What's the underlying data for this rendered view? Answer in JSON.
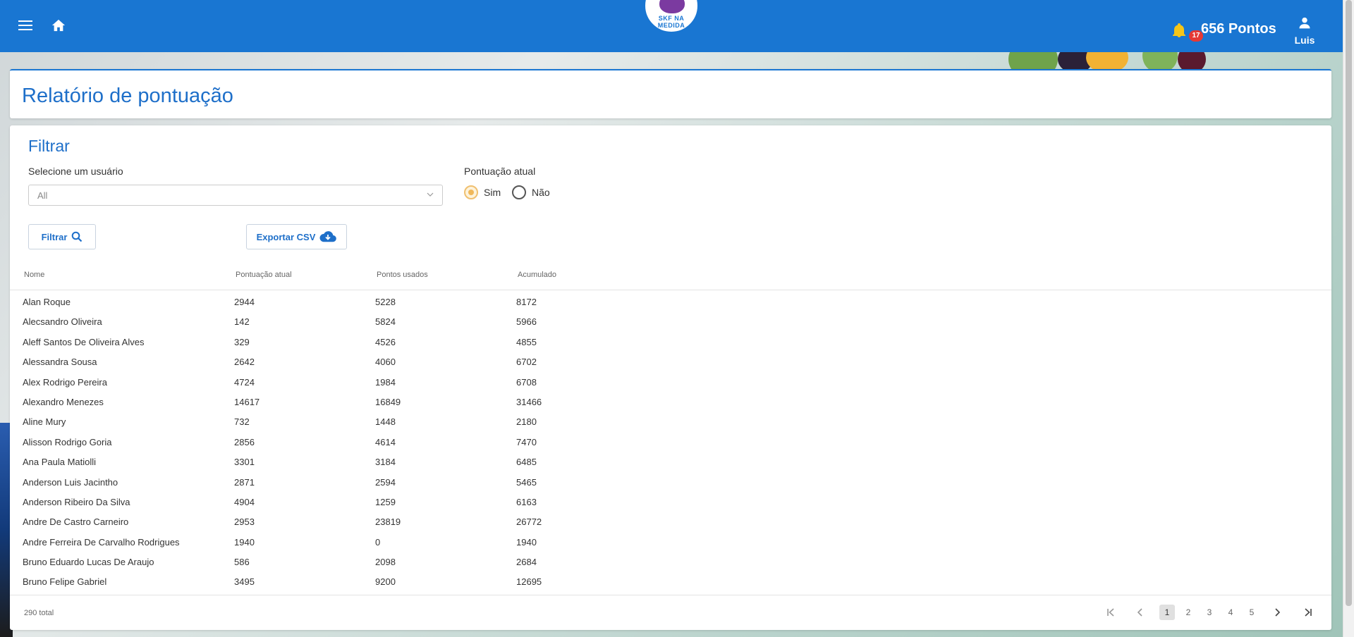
{
  "topbar": {
    "logo_text": "SKF NA MEDIDA",
    "notification_count": "17",
    "points": "656 Pontos",
    "user_name": "Luis"
  },
  "page": {
    "title": "Relatório de pontuação"
  },
  "filter": {
    "title": "Filtrar",
    "user_label": "Selecione um usuário",
    "user_value": "All",
    "pont_label": "Pontuação atual",
    "radio_yes": "Sim",
    "radio_no": "Não",
    "radio_selected": "Sim",
    "filter_button": "Filtrar",
    "export_button": "Exportar CSV"
  },
  "table": {
    "headers": [
      "Nome",
      "Pontuação atual",
      "Pontos usados",
      "Acumulado"
    ],
    "rows": [
      [
        "Alan Roque",
        "2944",
        "5228",
        "8172"
      ],
      [
        "Alecsandro Oliveira",
        "142",
        "5824",
        "5966"
      ],
      [
        "Aleff Santos De Oliveira Alves",
        "329",
        "4526",
        "4855"
      ],
      [
        "Alessandra Sousa",
        "2642",
        "4060",
        "6702"
      ],
      [
        "Alex Rodrigo Pereira",
        "4724",
        "1984",
        "6708"
      ],
      [
        "Alexandro Menezes",
        "14617",
        "16849",
        "31466"
      ],
      [
        "Aline Mury",
        "732",
        "1448",
        "2180"
      ],
      [
        "Alisson Rodrigo Goria",
        "2856",
        "4614",
        "7470"
      ],
      [
        "Ana Paula Matiolli",
        "3301",
        "3184",
        "6485"
      ],
      [
        "Anderson Luis Jacintho",
        "2871",
        "2594",
        "5465"
      ],
      [
        "Anderson Ribeiro Da Silva",
        "4904",
        "1259",
        "6163"
      ],
      [
        "Andre De Castro Carneiro",
        "2953",
        "23819",
        "26772"
      ],
      [
        "Andre Ferreira De Carvalho Rodrigues",
        "1940",
        "0",
        "1940"
      ],
      [
        "Bruno Eduardo Lucas De Araujo",
        "586",
        "2098",
        "2684"
      ],
      [
        "Bruno Felipe Gabriel",
        "3495",
        "9200",
        "12695"
      ]
    ]
  },
  "pagination": {
    "total": "290 total",
    "pages": [
      "1",
      "2",
      "3",
      "4",
      "5"
    ],
    "active_page": "1"
  },
  "colors": {
    "primary": "#1976d2",
    "badge": "#e53935",
    "radio_selected": "#f0b85a"
  }
}
